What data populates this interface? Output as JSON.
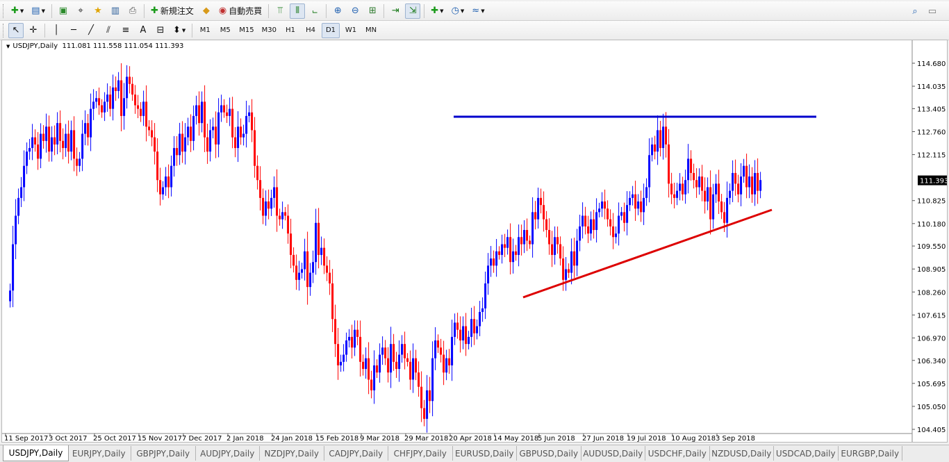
{
  "toolbar_top": {
    "new_order_label": "新規注文",
    "auto_trade_label": "自動売買"
  },
  "toolbar_tools": {
    "text_tool_label": "A",
    "timeframes": [
      "M1",
      "M5",
      "M15",
      "M30",
      "H1",
      "H4",
      "D1",
      "W1",
      "MN"
    ],
    "active_timeframe": "D1"
  },
  "chart_header": {
    "symbol": "USDJPY,Daily",
    "ohlc": "111.081 111.558 111.054 111.393"
  },
  "tabs": {
    "items": [
      "USDJPY,Daily",
      "EURJPY,Daily",
      "GBPJPY,Daily",
      "AUDJPY,Daily",
      "NZDJPY,Daily",
      "CADJPY,Daily",
      "CHFJPY,Daily",
      "EURUSD,Daily",
      "GBPUSD,Daily",
      "AUDUSD,Daily",
      "USDCHF,Daily",
      "NZDUSD,Daily",
      "USDCAD,Daily",
      "EURGBP,Daily"
    ],
    "active": "USDJPY,Daily"
  },
  "colors": {
    "bull": "#0000ff",
    "bear": "#ff0000",
    "resistance": "#0000cc",
    "support": "#dd0000"
  },
  "chart_data": {
    "type": "candlestick",
    "symbol": "USDJPY",
    "timeframe": "Daily",
    "ylim": [
      104.0,
      115.0
    ],
    "y_ticks": [
      114.68,
      114.035,
      113.405,
      112.76,
      112.115,
      110.825,
      110.18,
      109.55,
      108.905,
      108.26,
      107.615,
      106.97,
      106.34,
      105.695,
      105.05,
      104.405
    ],
    "current_price": "111.393",
    "x_tick_labels": [
      "11 Sep 2017",
      "3 Oct 2017",
      "25 Oct 2017",
      "15 Nov 2017",
      "7 Dec 2017",
      "2 Jan 2018",
      "24 Jan 2018",
      "15 Feb 2018",
      "9 Mar 2018",
      "29 Mar 2018",
      "20 Apr 2018",
      "14 May 2018",
      "5 Jun 2018",
      "27 Jun 2018",
      "19 Jul 2018",
      "10 Aug 2018",
      "3 Sep 2018"
    ],
    "bars_per_tick": 16,
    "x_start_index": -0.9,
    "closes": [
      108.3,
      109.6,
      110.4,
      110.9,
      111.2,
      111.8,
      112.2,
      112.3,
      112.6,
      112.4,
      112.0,
      112.7,
      112.5,
      112.9,
      112.2,
      112.6,
      112.4,
      113.0,
      112.5,
      112.3,
      112.7,
      112.2,
      112.8,
      112.0,
      111.8,
      112.0,
      112.7,
      113.0,
      112.6,
      113.4,
      113.6,
      113.7,
      113.5,
      113.3,
      113.6,
      113.8,
      113.4,
      114.0,
      113.9,
      114.2,
      113.2,
      113.7,
      114.3,
      114.1,
      113.8,
      113.5,
      113.4,
      113.2,
      113.6,
      112.9,
      112.8,
      112.6,
      112.2,
      111.4,
      111.0,
      111.2,
      111.5,
      111.2,
      111.8,
      112.3,
      112.1,
      112.7,
      112.2,
      112.6,
      112.9,
      112.5,
      113.2,
      113.5,
      113.0,
      113.6,
      112.6,
      112.2,
      112.8,
      112.9,
      112.4,
      113.3,
      113.5,
      113.3,
      113.2,
      113.4,
      112.6,
      112.3,
      112.9,
      112.6,
      112.7,
      113.2,
      113.3,
      112.8,
      111.8,
      111.4,
      110.9,
      110.4,
      110.8,
      110.6,
      110.9,
      111.2,
      110.4,
      110.3,
      110.5,
      110.4,
      109.9,
      109.3,
      109.0,
      108.6,
      108.8,
      108.9,
      109.4,
      108.4,
      108.8,
      109.1,
      110.2,
      109.3,
      109.5,
      109.0,
      108.8,
      108.5,
      107.5,
      106.8,
      106.2,
      106.3,
      106.5,
      106.9,
      107.0,
      106.7,
      107.2,
      107.0,
      106.3,
      106.1,
      106.4,
      105.8,
      105.5,
      106.2,
      106.0,
      106.5,
      106.7,
      106.4,
      106.0,
      106.8,
      106.3,
      106.1,
      106.5,
      106.8,
      106.4,
      106.3,
      105.8,
      106.4,
      106.0,
      105.6,
      105.0,
      104.7,
      105.5,
      105.2,
      106.4,
      106.9,
      106.7,
      106.5,
      106.0,
      106.4,
      106.2,
      107.0,
      107.4,
      107.2,
      106.9,
      107.3,
      106.8,
      107.0,
      107.5,
      107.1,
      107.3,
      107.7,
      107.8,
      108.5,
      109.0,
      109.2,
      109.0,
      109.4,
      109.3,
      109.6,
      109.5,
      109.8,
      109.1,
      109.4,
      109.3,
      109.8,
      109.6,
      110.0,
      109.7,
      109.6,
      110.5,
      110.3,
      110.9,
      110.7,
      110.3,
      110.0,
      109.6,
      109.3,
      109.8,
      109.6,
      109.2,
      108.6,
      108.9,
      108.8,
      109.4,
      109.0,
      109.7,
      110.1,
      110.4,
      110.1,
      109.9,
      110.3,
      110.0,
      110.5,
      110.6,
      110.8,
      110.6,
      110.3,
      110.1,
      109.8,
      109.9,
      110.4,
      110.5,
      110.2,
      110.7,
      110.9,
      111.0,
      110.6,
      110.8,
      110.5,
      110.9,
      111.2,
      112.1,
      112.4,
      112.2,
      112.8,
      112.3,
      112.9,
      112.4,
      111.3,
      111.0,
      110.9,
      111.1,
      111.3,
      111.0,
      111.4,
      112.0,
      111.6,
      111.4,
      111.2,
      111.5,
      111.1,
      110.8,
      111.2,
      110.3,
      111.0,
      111.3,
      110.8,
      110.5,
      110.2,
      110.9,
      111.1,
      111.6,
      111.3,
      111.0,
      111.5,
      111.8,
      111.2,
      111.5,
      111.0,
      111.6,
      111.1,
      111.4
    ]
  }
}
